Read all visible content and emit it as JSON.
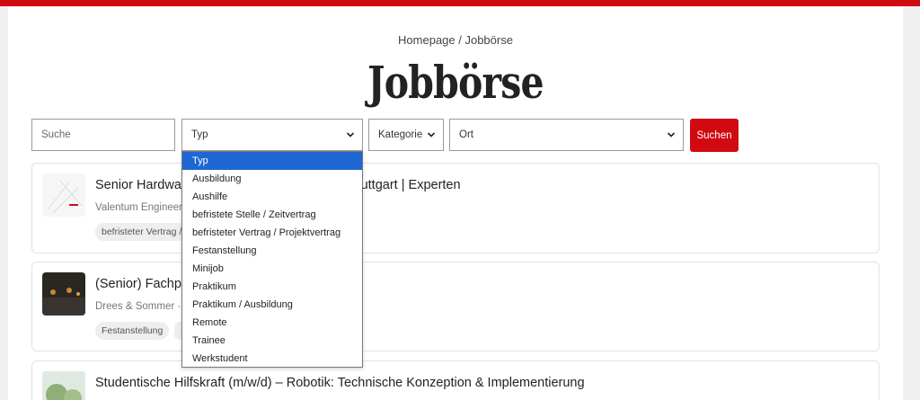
{
  "breadcrumb": "Homepage / Jobbörse",
  "page_title": "Jobbörse",
  "filters": {
    "search_placeholder": "Suche",
    "typ_value": "Typ",
    "kategorie_value": "Kategorie",
    "ort_value": "Ort",
    "search_button": "Suchen"
  },
  "typ_dropdown": {
    "options": [
      "Typ",
      "Ausbildung",
      "Aushilfe",
      "befristete Stelle / Zeitvertrag",
      "befristeter Vertrag / Projektvertrag",
      "Festanstellung",
      "Minijob",
      "Praktikum",
      "Praktikum / Ausbildung",
      "Remote",
      "Trainee",
      "Werkstudent"
    ],
    "selected": "Typ"
  },
  "jobs": [
    {
      "title_visible": "Senior Hardware",
      "title_tail": "g | Stuttgart | Experten",
      "meta": "Valentum Engineeri",
      "tag": "befristeter Vertrag /"
    },
    {
      "title_visible": "(Senior) Fachpla",
      "meta": "Drees & Sommer · S",
      "tag": "Festanstellung"
    },
    {
      "title_visible": "Studentische Hilfskraft (m/w/d) – Robotik: Technische Konzeption & Implementierung"
    }
  ],
  "colors": {
    "brand_red": "#d10a11",
    "selected_option": "#1e67d3"
  }
}
